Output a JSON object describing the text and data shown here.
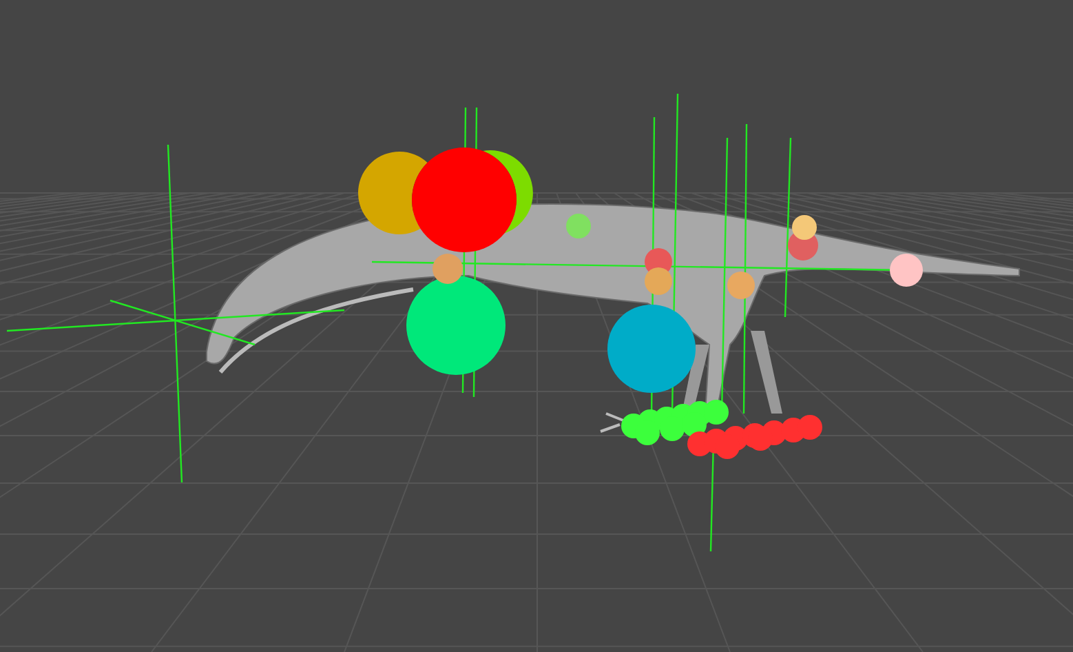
{
  "viewport": {
    "controls": [
      {
        "color": "#d4a600"
      },
      {
        "color": "#7ddc00"
      },
      {
        "color": "#ff0000"
      },
      {
        "color": "#00e87a"
      },
      {
        "color": "#00acc8"
      },
      {
        "color": "#e0a060"
      },
      {
        "color": "#80e060"
      },
      {
        "color": "#ffc4c4"
      },
      {
        "color": "#e8a860"
      },
      {
        "color": "#e06060"
      },
      {
        "color": "#f4c878"
      },
      {
        "color": "#e85858"
      },
      {
        "color": "#e4a858"
      },
      {
        "color": "#3cff3c"
      },
      {
        "color": "#ff3030"
      }
    ]
  }
}
